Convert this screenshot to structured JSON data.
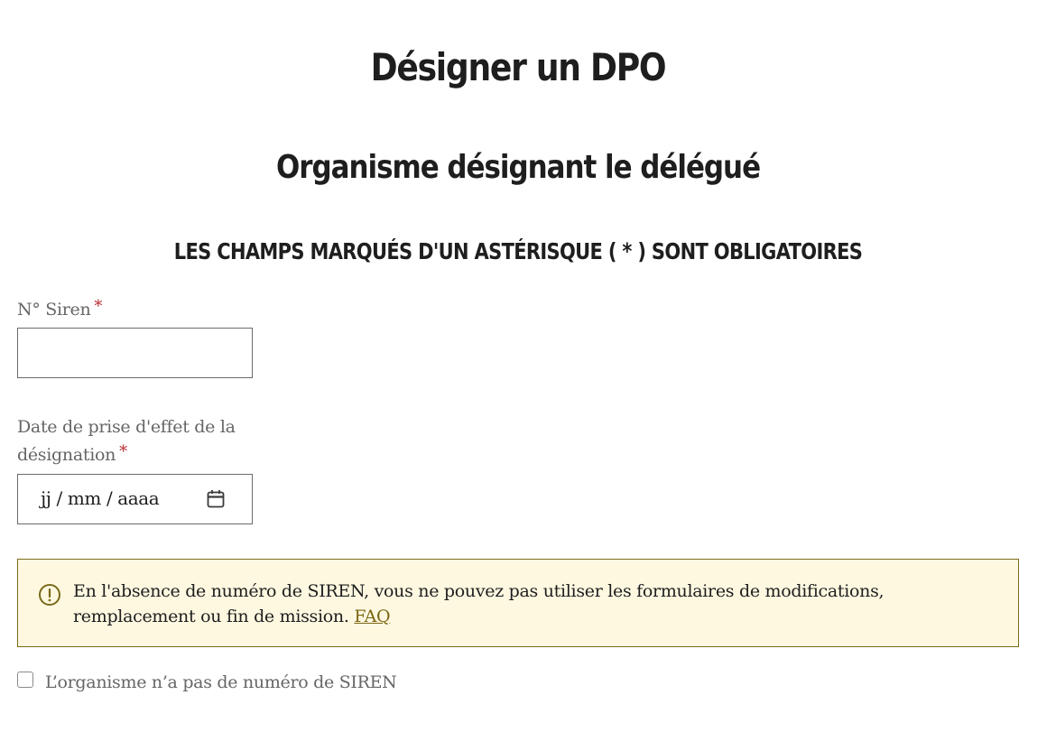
{
  "page": {
    "title": "Désigner un DPO",
    "section_title": "Organisme désignant le délégué",
    "required_note": "LES CHAMPS MARQUÉS D'UN ASTÉRISQUE ( * ) SONT OBLIGATOIRES"
  },
  "form": {
    "siren": {
      "label": "N° Siren",
      "required_mark": "*",
      "value": "",
      "placeholder": ""
    },
    "effective_date": {
      "label": "Date de prise d'effet de la désignation",
      "required_mark": "*",
      "placeholder": "jj / mm / aaaa",
      "icon": "calendar-icon"
    },
    "alert": {
      "icon": "exclamation-circle-icon",
      "text": "En l'absence de numéro de SIREN, vous ne pouvez pas utiliser les formulaires de modifications, remplacement ou fin de mission.",
      "link_label": "FAQ"
    },
    "no_siren_checkbox": {
      "label": "L’organisme n’a pas de numéro de SIREN",
      "checked": false
    }
  },
  "colors": {
    "text": "#1e1e1e",
    "label": "#666666",
    "required": "#b8282e",
    "alert_background": "#fff8e1",
    "alert_border": "#7a6a1a",
    "link": "#7a6612"
  }
}
